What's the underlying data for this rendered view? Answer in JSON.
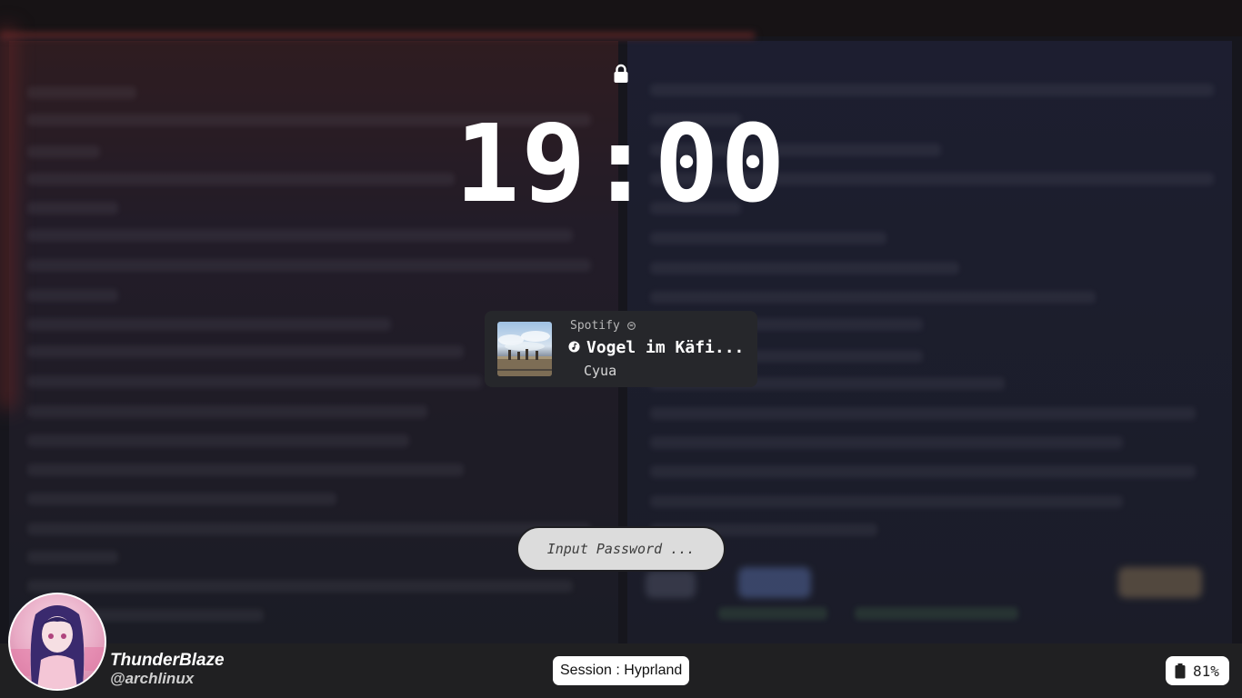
{
  "lockscreen": {
    "time": "19:00",
    "lock_icon": "lock-icon"
  },
  "media": {
    "player": "Spotify",
    "title": "Vogel im Käfi...",
    "artist": "Cyua",
    "note_icon": "music-note-icon"
  },
  "password": {
    "placeholder": "Input Password ..."
  },
  "user": {
    "name": "ThunderBlaze",
    "handle": "@archlinux"
  },
  "session": {
    "label": "Session : Hyprland"
  },
  "battery": {
    "level": "81%",
    "icon": "battery-icon"
  },
  "colors": {
    "card_bg": "#26272b",
    "bar_bg": "#202022",
    "input_bg": "#dcdcdc"
  }
}
